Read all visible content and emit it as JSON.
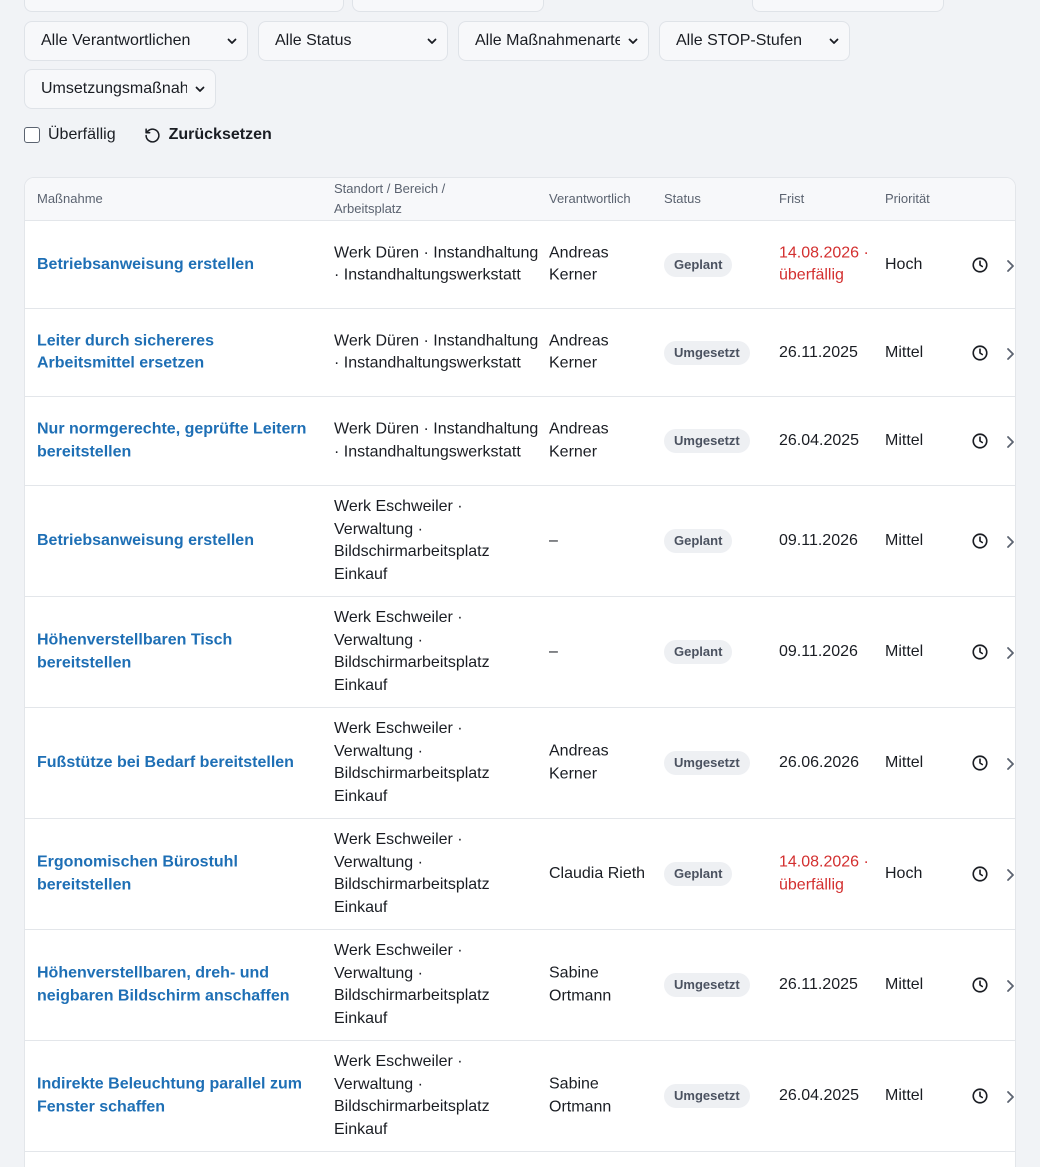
{
  "filters": {
    "owner": "Alle Verantwortlichen",
    "status": "Alle Status",
    "measure_type": "Alle Maßnahmenarten",
    "stop_level": "Alle STOP-Stufen",
    "implementation": "Umsetzungsmaßnahmen"
  },
  "toggles": {
    "overdue_label": "Überfällig",
    "reset_label": "Zurücksetzen"
  },
  "table": {
    "headers": {
      "measure": "Maßnahme",
      "location": "Standort / Bereich / Arbeitsplatz",
      "owner": "Verantwortlich",
      "status": "Status",
      "deadline": "Frist",
      "priority": "Priorität"
    },
    "rows": [
      {
        "title": "Betriebsanweisung erstellen",
        "location": "Werk Düren · Instandhaltung · Instandhaltungswerkstatt",
        "owner": "Andreas Kerner",
        "status": "Geplant",
        "deadline": "14.08.2026 · überfällig",
        "overdue": true,
        "priority": "Hoch"
      },
      {
        "title": "Leiter durch sichereres Arbeitsmittel ersetzen",
        "location": "Werk Düren · Instandhaltung · Instandhaltungswerkstatt",
        "owner": "Andreas Kerner",
        "status": "Umgesetzt",
        "deadline": "26.11.2025",
        "overdue": false,
        "priority": "Mittel"
      },
      {
        "title": "Nur normgerechte, geprüfte Leitern bereitstellen",
        "location": "Werk Düren · Instandhaltung · Instandhaltungswerkstatt",
        "owner": "Andreas Kerner",
        "status": "Umgesetzt",
        "deadline": "26.04.2025",
        "overdue": false,
        "priority": "Mittel"
      },
      {
        "title": "Betriebsanweisung erstellen",
        "location": "Werk Eschweiler · Verwaltung · Bildschirmarbeitsplatz Einkauf",
        "owner": "–",
        "status": "Geplant",
        "deadline": "09.11.2026",
        "overdue": false,
        "priority": "Mittel"
      },
      {
        "title": "Höhenverstellbaren Tisch bereitstellen",
        "location": "Werk Eschweiler · Verwaltung · Bildschirmarbeitsplatz Einkauf",
        "owner": "–",
        "status": "Geplant",
        "deadline": "09.11.2026",
        "overdue": false,
        "priority": "Mittel"
      },
      {
        "title": "Fußstütze bei Bedarf bereitstellen",
        "location": "Werk Eschweiler · Verwaltung · Bildschirmarbeitsplatz Einkauf",
        "owner": "Andreas Kerner",
        "status": "Umgesetzt",
        "deadline": "26.06.2026",
        "overdue": false,
        "priority": "Mittel"
      },
      {
        "title": "Ergonomischen Bürostuhl bereitstellen",
        "location": "Werk Eschweiler · Verwaltung · Bildschirmarbeitsplatz Einkauf",
        "owner": "Claudia Rieth",
        "status": "Geplant",
        "deadline": "14.08.2026 · überfällig",
        "overdue": true,
        "priority": "Hoch"
      },
      {
        "title": "Höhenverstellbaren, dreh- und neigbaren Bildschirm anschaffen",
        "location": "Werk Eschweiler · Verwaltung · Bildschirmarbeitsplatz Einkauf",
        "owner": "Sabine Ortmann",
        "status": "Umgesetzt",
        "deadline": "26.11.2025",
        "overdue": false,
        "priority": "Mittel"
      },
      {
        "title": "Indirekte Beleuchtung parallel zum Fenster schaffen",
        "location": "Werk Eschweiler · Verwaltung · Bildschirmarbeitsplatz Einkauf",
        "owner": "Sabine Ortmann",
        "status": "Umgesetzt",
        "deadline": "26.04.2025",
        "overdue": false,
        "priority": "Mittel"
      }
    ]
  },
  "colors": {
    "link": "#1e6fb5",
    "overdue": "#d32f2f",
    "background": "#f1f3f6",
    "badge_bg": "#eef0f3"
  },
  "icons": {
    "row_history": "clock-icon",
    "row_open": "chevron-right-icon",
    "select": "chevron-down-icon",
    "reset": "rotate-ccw-icon"
  }
}
